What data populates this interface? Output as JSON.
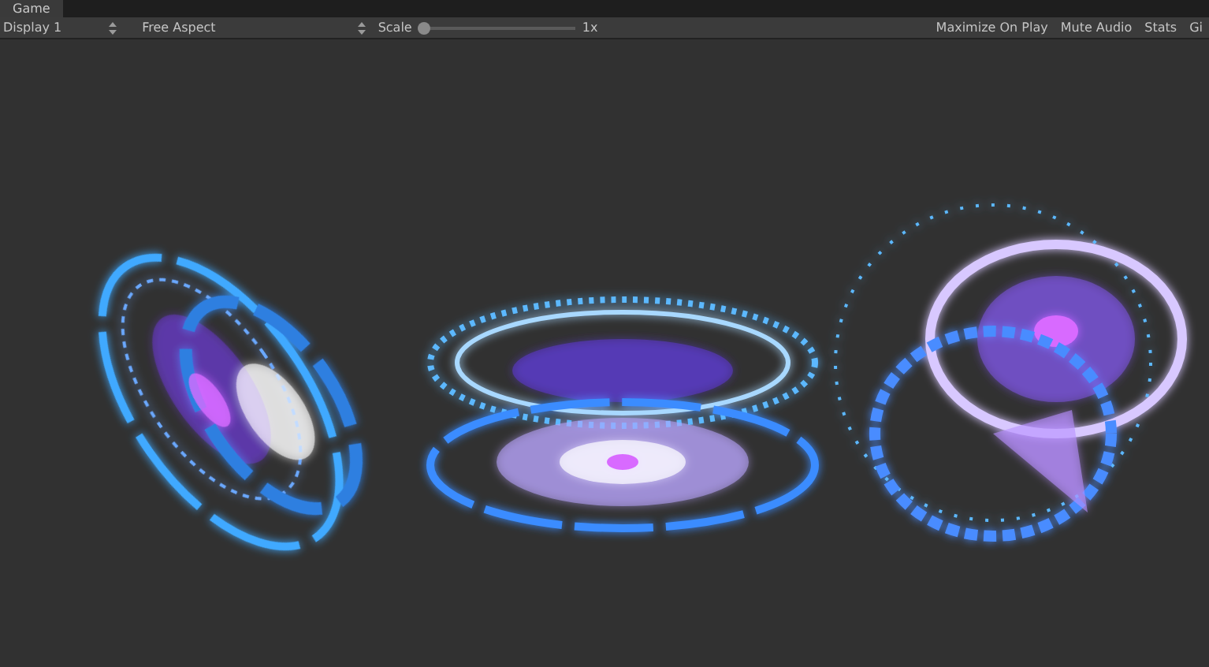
{
  "tab": {
    "title": "Game"
  },
  "toolbar": {
    "display": "Display 1",
    "aspect": "Free Aspect",
    "scale": {
      "label": "Scale",
      "level": 0.0,
      "reading": "1x"
    },
    "buttons": [
      "Maximize On Play",
      "Mute Audio",
      "Stats",
      "Gi"
    ]
  }
}
